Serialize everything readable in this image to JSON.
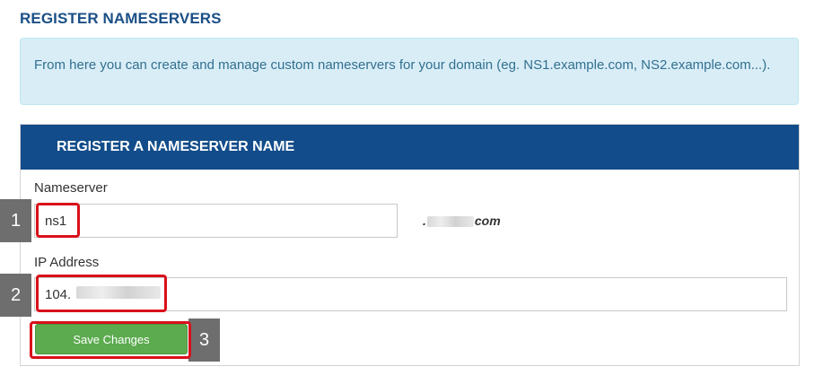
{
  "page": {
    "title": "REGISTER NAMESERVERS",
    "info_text": "From here you can create and manage custom nameservers for your domain (eg. NS1.example.com, NS2.example.com...)."
  },
  "panel": {
    "title": "REGISTER A NAMESERVER NAME",
    "nameserver": {
      "label": "Nameserver",
      "value": "ns1",
      "domain_suffix_prefix": ".",
      "domain_suffix_tld": "com"
    },
    "ip_address": {
      "label": "IP Address",
      "value": "104."
    },
    "save_label": "Save Changes"
  },
  "annotations": {
    "step1": "1",
    "step2": "2",
    "step3": "3"
  },
  "colors": {
    "title": "#1a4f86",
    "panel_header": "#124c8a",
    "info_bg": "#d9edf7",
    "save_button": "#5cab4f",
    "highlight": "#d9101a",
    "badge": "#6e6e6e"
  }
}
